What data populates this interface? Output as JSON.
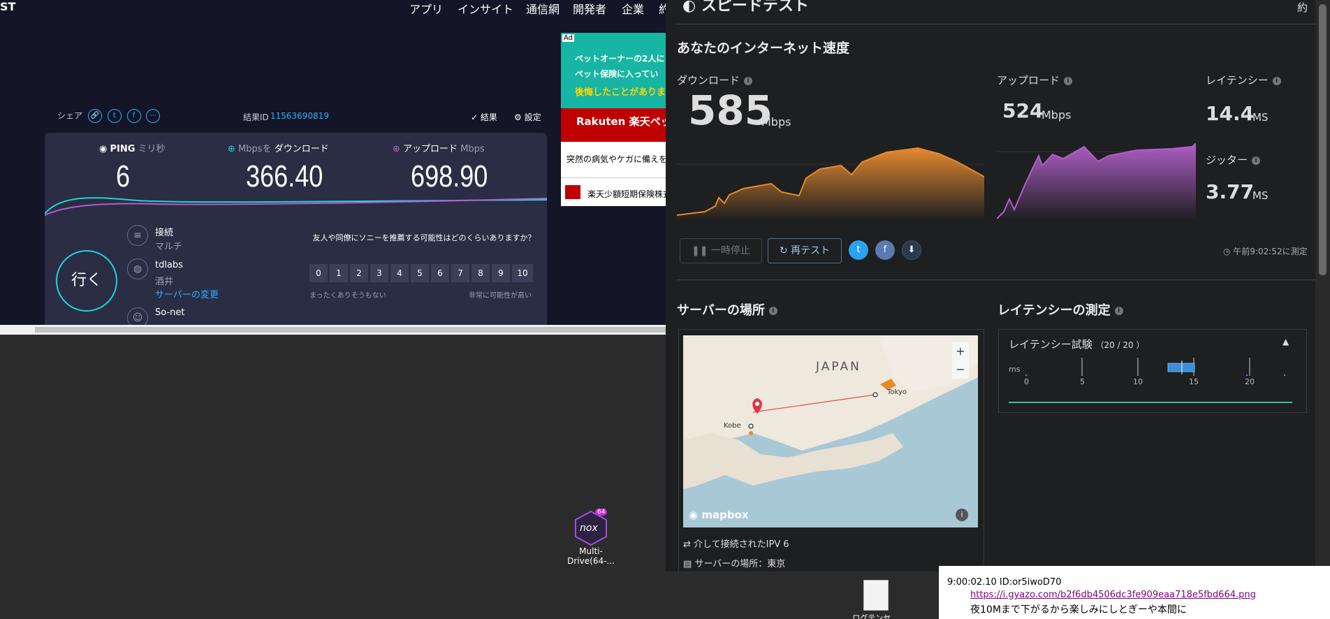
{
  "left": {
    "logo": "ST",
    "nav": [
      "アプリ",
      "インサイト",
      "通信網",
      "開発者",
      "企業",
      "約"
    ],
    "share_label": "シェア",
    "result_id_label": "結果ID",
    "result_id": "11563690819",
    "results_label": "結果",
    "settings_label": "設定",
    "ping": {
      "label": "PING",
      "unit": "ミリ秒",
      "value": "6"
    },
    "download": {
      "unit": "Mbpsを",
      "label": "ダウンロード",
      "value": "366.40"
    },
    "upload": {
      "label": "アップロード",
      "unit": "Mbps",
      "value": "698.90"
    },
    "go_label": "行く",
    "connection": {
      "label": "接続",
      "value": "マルチ"
    },
    "server": {
      "name": "tdlabs",
      "city": "酒井",
      "change_link": "サーバーの変更"
    },
    "isp": {
      "name": "So-net"
    },
    "nps": {
      "question": "友人や同僚にソニーを推薦する可能性はどのくらいありますか？",
      "scale": [
        "0",
        "1",
        "2",
        "3",
        "4",
        "5",
        "6",
        "7",
        "8",
        "9",
        "10"
      ],
      "low_label": "まったくありそうもない",
      "high_label": "非常に可能性が高い"
    }
  },
  "ad": {
    "badge": "Ad",
    "line1": "ペットオーナーの2人に",
    "line2": "ペット保険に入ってい",
    "line3": "後悔したことがありま",
    "brand": "Rakuten 楽天ペット",
    "tagline": "突然の病気やケガに備えを",
    "footer": "楽天少額短期保険株式"
  },
  "speedtest": {
    "title": "スピードテスト",
    "corner": "約",
    "heading": "あなたのインターネット速度",
    "download": {
      "label": "ダウンロード",
      "value": "585",
      "unit": "Mbps"
    },
    "upload": {
      "label": "アップロード",
      "value": "524",
      "unit": "Mbps"
    },
    "latency": {
      "label": "レイテンシー",
      "value": "14.4",
      "unit": "MS"
    },
    "jitter": {
      "label": "ジッター",
      "value": "3.77",
      "unit": "MS"
    },
    "pause_label": "一時停止",
    "retest_label": "再テスト",
    "timestamp": "午前9:02:52に測定",
    "server_heading": "サーバーの場所",
    "latency_heading": "レイテンシーの測定",
    "map": {
      "country": "JAPAN",
      "city_a": "Kobe",
      "city_b": "Tokyo",
      "attribution": "mapbox",
      "zoom_in": "+",
      "zoom_out": "−"
    },
    "connected_via": "介して接続されたIPV 6",
    "server_location": "サーバーの場所：東京",
    "latency_test": {
      "label": "レイテンシー試験",
      "count": "（20 / 20 ）",
      "unit": "ms",
      "ticks": [
        "0",
        "5",
        "10",
        "15",
        "20"
      ]
    }
  },
  "desktop": {
    "icon_label": "Multi-Drive(64-...",
    "icon_badge": "64",
    "icon_name": "nox",
    "file_label": "ログテンセ..."
  },
  "bbs": {
    "line1": "9:00:02.10 ID:or5iwoD70",
    "link": "https://i.gyazo.com/b2f6db4506dc3fe909eaa718e5fbd664.png",
    "line3": "夜10Mまで下がるから楽しみにしとぎーや本間に"
  },
  "colors": {
    "accent_cyan": "#1ed6d6",
    "download_orange": "#e58a2d",
    "upload_purple": "#b05fc8",
    "link_blue": "#2ab2ff"
  }
}
